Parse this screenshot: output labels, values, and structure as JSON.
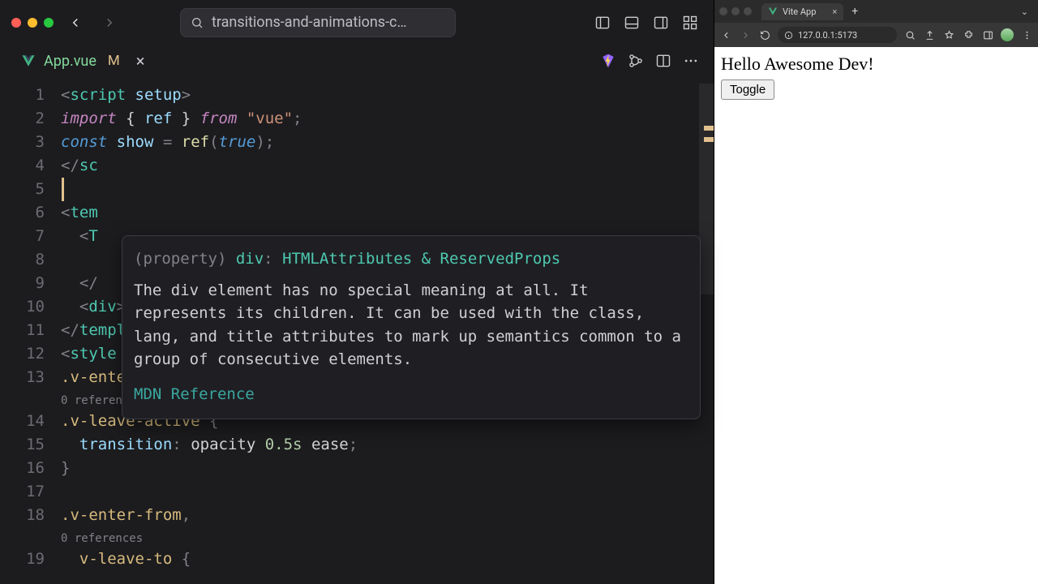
{
  "window": {
    "search_hint": "transitions-and-animations-c…"
  },
  "tab": {
    "filename": "App.vue",
    "modified_flag": "M"
  },
  "code": {
    "line1": "<script setup>",
    "line2_a": "import",
    "line2_b": " { ",
    "line2_c": "ref",
    "line2_d": " } ",
    "line2_e": "from",
    "line2_f": " \"vue\"",
    "line2_g": ";",
    "line3": "const show = ref(true);",
    "line4": "</sc",
    "line6": "<tem",
    "line7": "  <T",
    "line9": "  </",
    "line10": "  <div><button @click=\"show = !show\">Toggle</button></div>",
    "line11": "</template>",
    "line12": "<style scoped>",
    "line13": ".v-enter-active,",
    "ref1": "0 references",
    "line14": ".v-leave-active {",
    "line15": "  transition: opacity 0.5s ease;",
    "line16": "}",
    "line18": ".v-enter-from,",
    "ref2": "0 references",
    "line19": "  v-leave-to {"
  },
  "tooltip": {
    "prop_label": "(property)",
    "name": "div",
    "signature": "HTMLAttributes & ReservedProps",
    "description": "The div element has no special meaning at all. It represents its children. It can be used with the class, lang, and title attributes to mark up semantics common to a group of consecutive elements.",
    "link": "MDN Reference"
  },
  "gutter": [
    "1",
    "2",
    "3",
    "4",
    "5",
    "6",
    "7",
    "8",
    "9",
    "10",
    "11",
    "12",
    "13",
    "14",
    "15",
    "16",
    "17",
    "18",
    "19"
  ],
  "browser": {
    "tab_title": "Vite App",
    "url": "127.0.0.1:5173",
    "heading": "Hello Awesome Dev!",
    "button_label": "Toggle"
  },
  "colors": {
    "accent_teal": "#4ec9b0",
    "accent_gold": "#e2c08d"
  }
}
